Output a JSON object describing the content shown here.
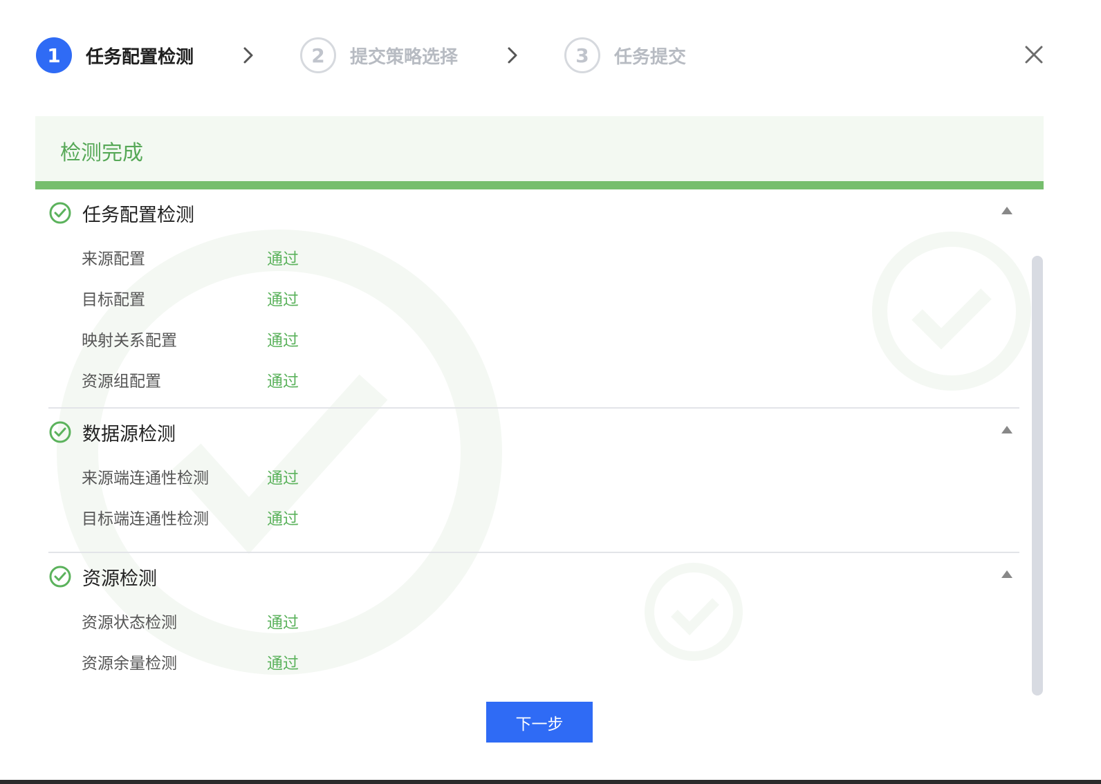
{
  "stepper": {
    "steps": [
      {
        "number": "1",
        "label": "任务配置检测",
        "state": "active"
      },
      {
        "number": "2",
        "label": "提交策略选择",
        "state": "inactive"
      },
      {
        "number": "3",
        "label": "任务提交",
        "state": "inactive"
      }
    ]
  },
  "banner": {
    "title": "检测完成"
  },
  "groups": [
    {
      "title": "任务配置检测",
      "items": [
        {
          "label": "来源配置",
          "status": "通过"
        },
        {
          "label": "目标配置",
          "status": "通过"
        },
        {
          "label": "映射关系配置",
          "status": "通过"
        },
        {
          "label": "资源组配置",
          "status": "通过"
        }
      ]
    },
    {
      "title": "数据源检测",
      "items": [
        {
          "label": "来源端连通性检测",
          "status": "通过"
        },
        {
          "label": "目标端连通性检测",
          "status": "通过"
        }
      ]
    },
    {
      "title": "资源检测",
      "items": [
        {
          "label": "资源状态检测",
          "status": "通过"
        },
        {
          "label": "资源余量检测",
          "status": "通过"
        }
      ]
    }
  ],
  "footer": {
    "next_label": "下一步"
  },
  "colors": {
    "primary": "#2f6bf5",
    "success": "#5bb25c",
    "banner_bg": "#f3f9f2",
    "banner_bar": "#76be6d"
  },
  "icons": {
    "close": "close-icon",
    "group_status": "check-circle-icon",
    "collapse": "caret-up-icon",
    "step_separator": "chevron-right-icon"
  }
}
